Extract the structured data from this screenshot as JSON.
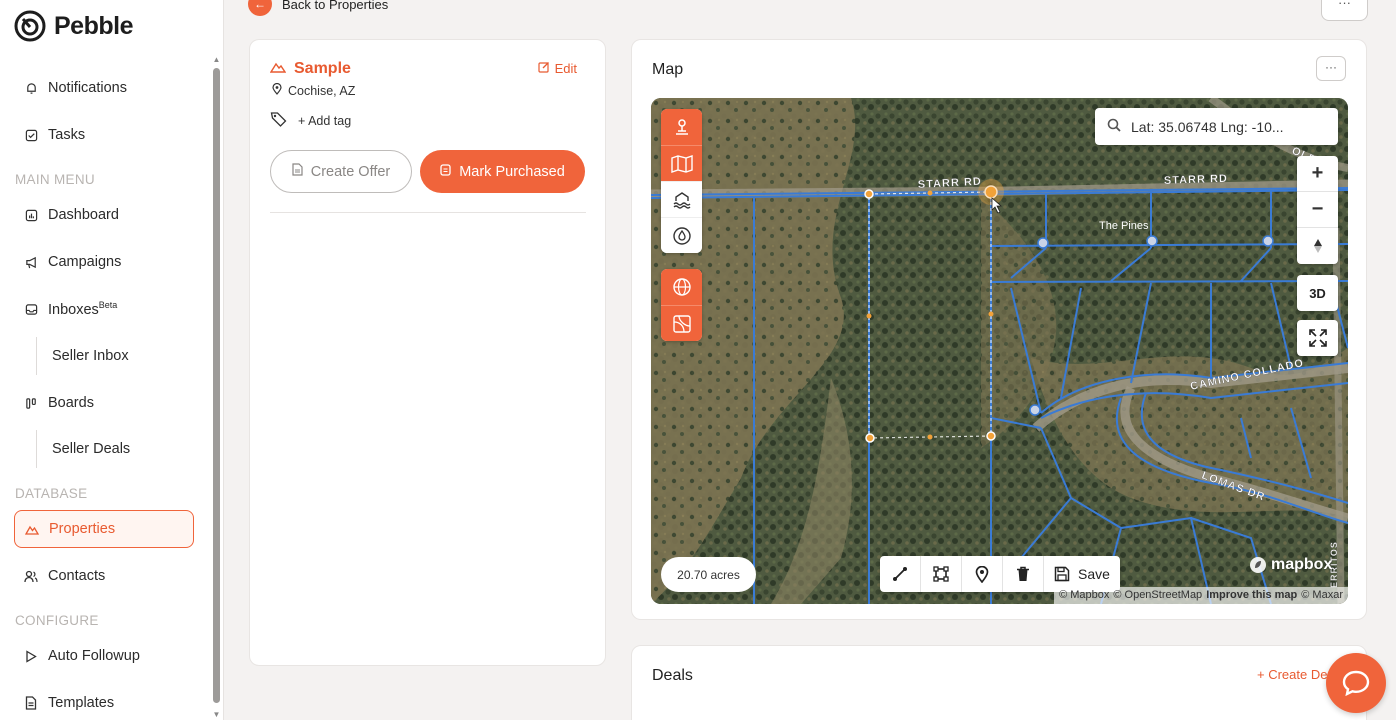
{
  "app": {
    "name": "Pebble"
  },
  "nav": {
    "notifications": "Notifications",
    "tasks": "Tasks",
    "main_menu_header": "MAIN MENU",
    "dashboard": "Dashboard",
    "campaigns": "Campaigns",
    "inboxes": "Inboxes",
    "inboxes_badge": "Beta",
    "seller_inbox": "Seller Inbox",
    "boards": "Boards",
    "seller_deals": "Seller Deals",
    "database_header": "DATABASE",
    "properties": "Properties",
    "contacts": "Contacts",
    "configure_header": "CONFIGURE",
    "auto_followup": "Auto Followup",
    "templates": "Templates"
  },
  "top": {
    "back_label": "Back to Properties",
    "more": "···"
  },
  "property": {
    "name": "Sample",
    "edit_label": "Edit",
    "location": "Cochise, AZ",
    "add_tag_label": "Add tag",
    "create_offer_label": "Create Offer",
    "mark_purchased_label": "Mark Purchased"
  },
  "map": {
    "title": "Map",
    "more": "···",
    "search_value": "Lat: 35.06748 Lng: -10...",
    "zoom_in": "+",
    "zoom_out": "−",
    "three_d": "3D",
    "acres": "20.70 acres",
    "save_label": "Save",
    "mapbox_label": "mapbox",
    "attribution_mapbox": "© Mapbox",
    "attribution_osm": "© OpenStreetMap",
    "attribution_improve": "Improve this map",
    "attribution_maxar": "© Maxar",
    "roads": {
      "starr_rd_1": "STARR RD",
      "starr_rd_2": "STARR RD",
      "old_rd": "OLD R",
      "the_pines": "The Pines",
      "camino": "CAMINO COLLADO",
      "lomas": "LOMAS DR",
      "side_road": "ERRITOS"
    }
  },
  "deals": {
    "title": "Deals",
    "create_label": "+ Create Deal"
  },
  "colors": {
    "accent": "#f0643b",
    "parcel_lines": "#3a7bd5",
    "selection": "#f2a23a"
  }
}
